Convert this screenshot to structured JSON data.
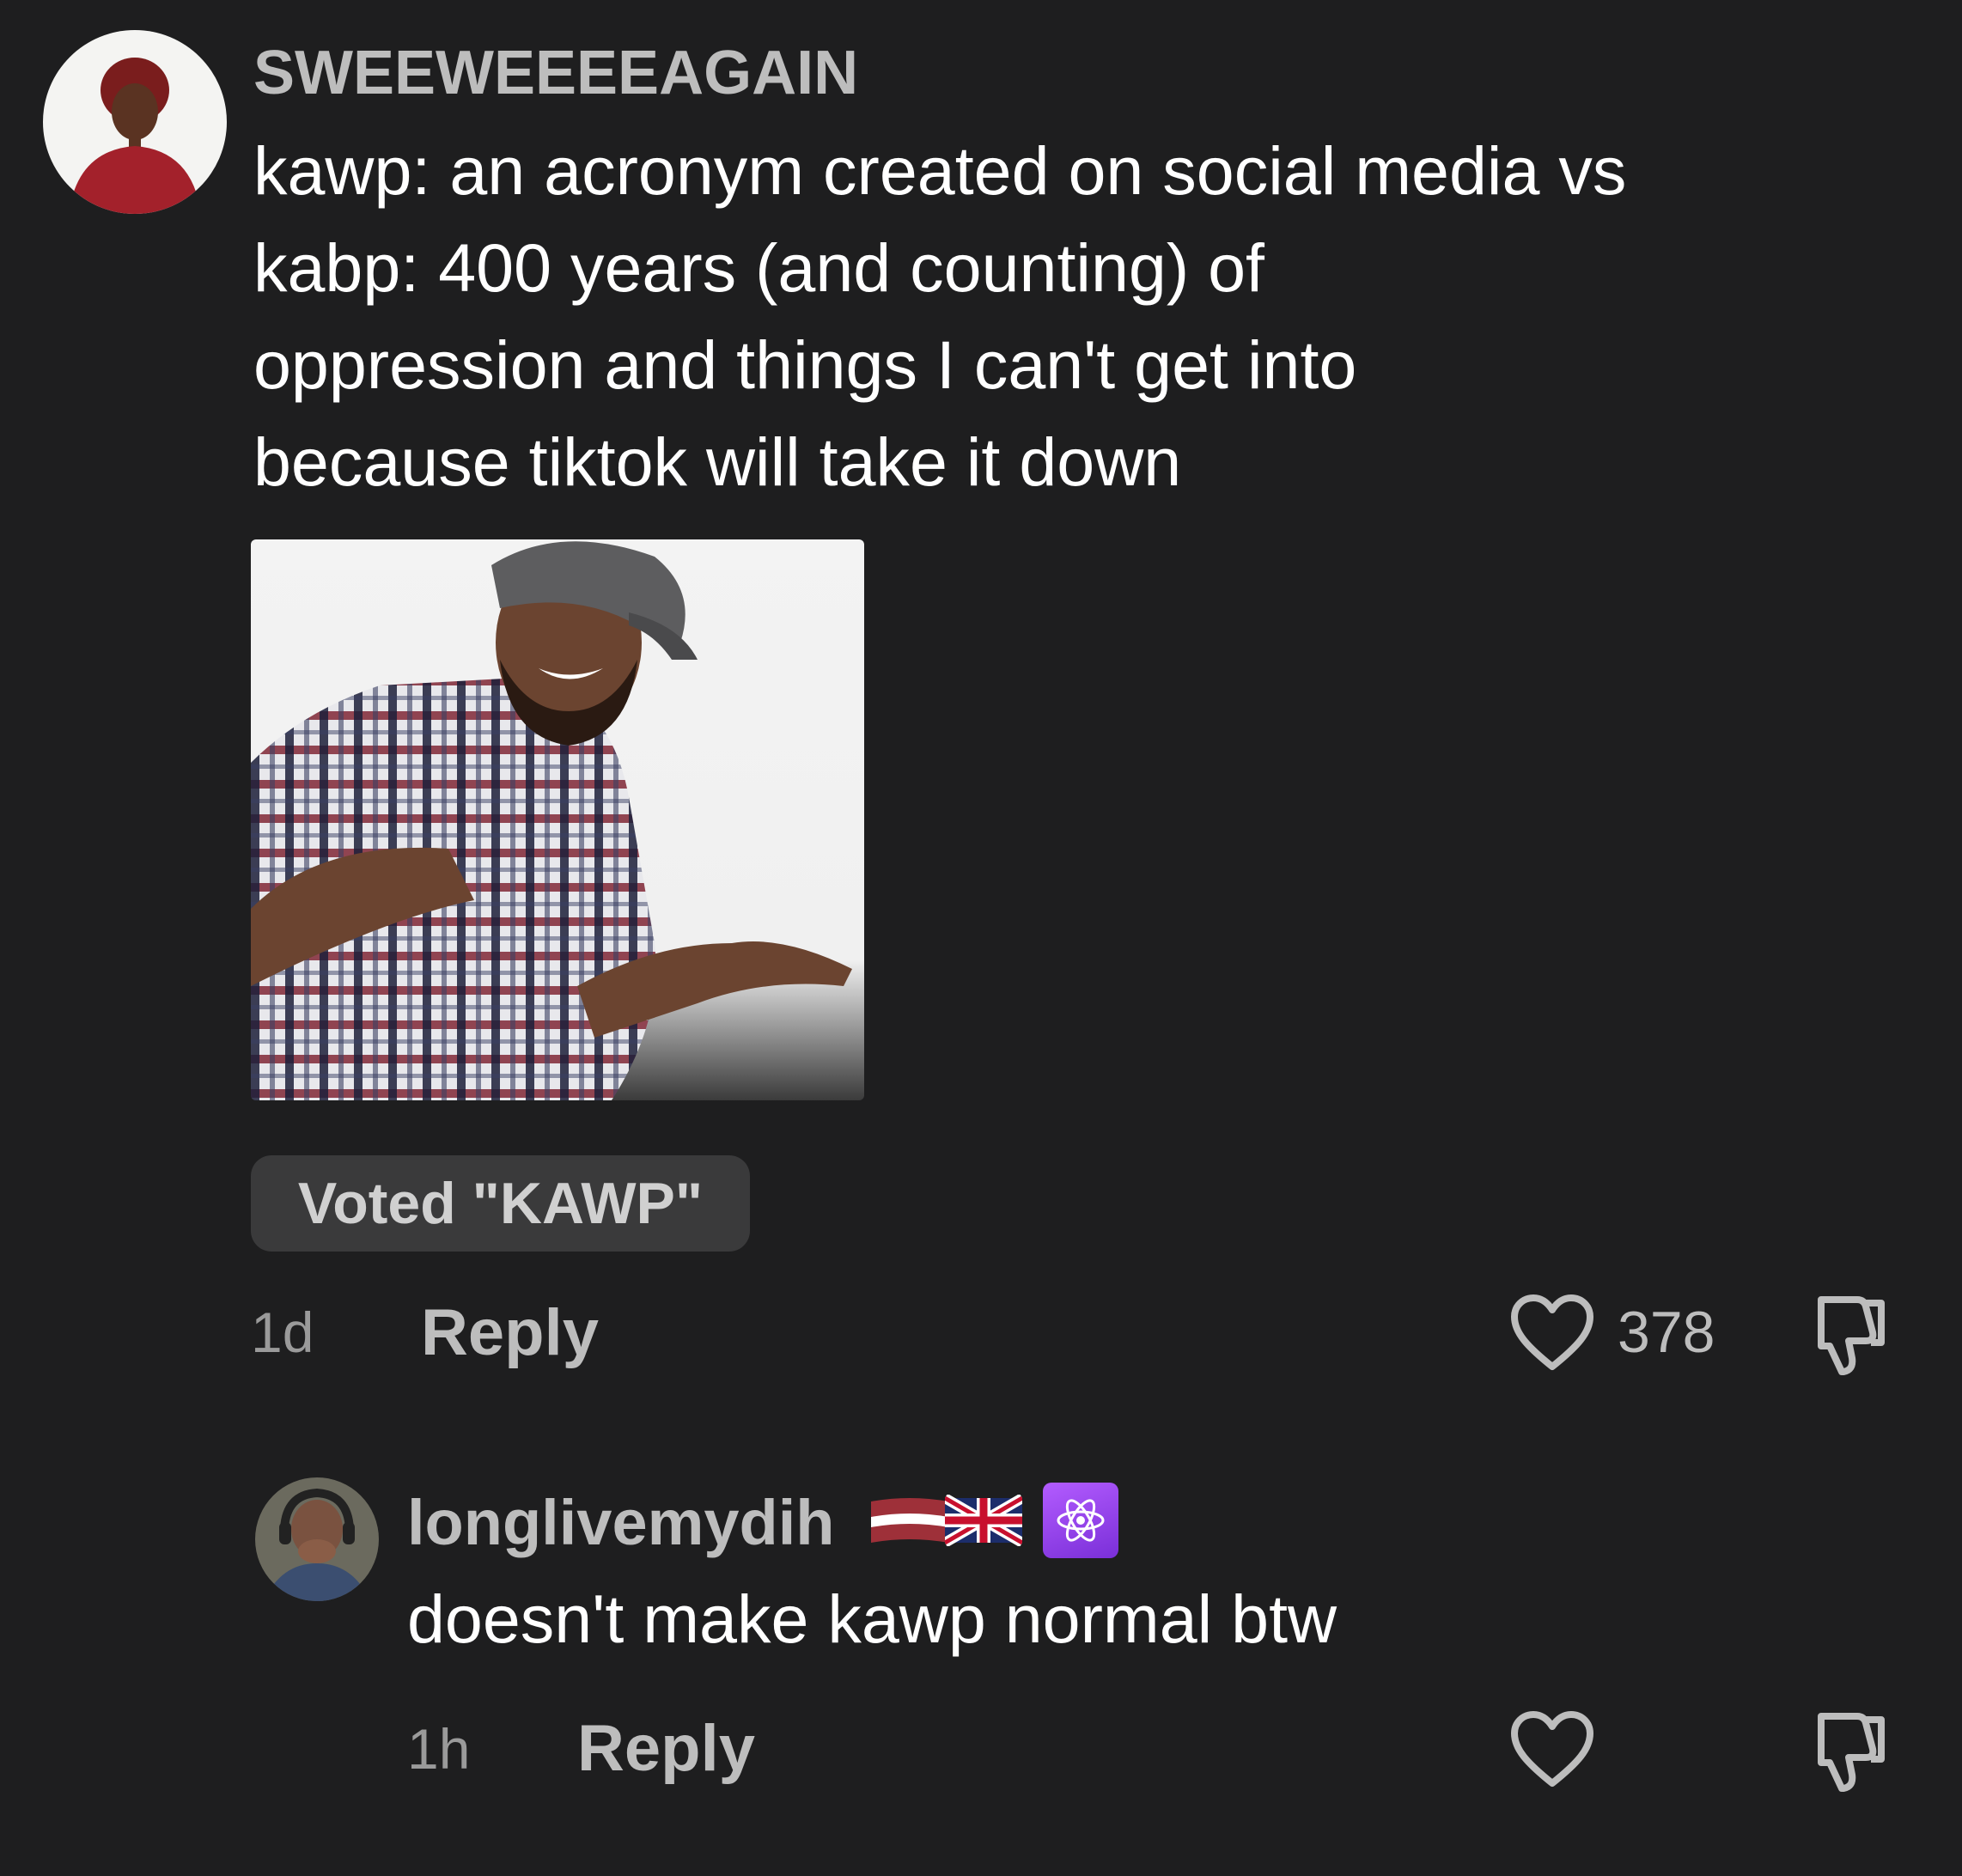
{
  "comments": [
    {
      "username": "SWEEWEEEEAGAIN",
      "text": "kawp: an acronym created on social media vs kabp: 400 years (and counting) of oppression and things I can't get into because tiktok will take it down",
      "lines": [
        "kawp: an acronym created on social media vs",
        "kabp: 400 years (and counting) of",
        "oppression and things I can't get into",
        "because tiktok will take it down"
      ],
      "vote_label": "Voted \"KAWP\"",
      "time": "1d",
      "reply_label": "Reply",
      "likes": "378"
    },
    {
      "username": "longlivemydih",
      "flags": [
        "latvia-flag-icon",
        "uk-flag-icon"
      ],
      "badge": "atom-icon",
      "text": "doesn't make kawp normal btw",
      "time": "1h",
      "reply_label": "Reply",
      "likes": ""
    }
  ],
  "colors": {
    "background": "#1e1e1f",
    "username": "#bdbdbd",
    "body": "#ffffff",
    "meta": "#9a9a9a",
    "vote_badge": "#3a3a3b",
    "badge_purple": "#9b45f0"
  }
}
